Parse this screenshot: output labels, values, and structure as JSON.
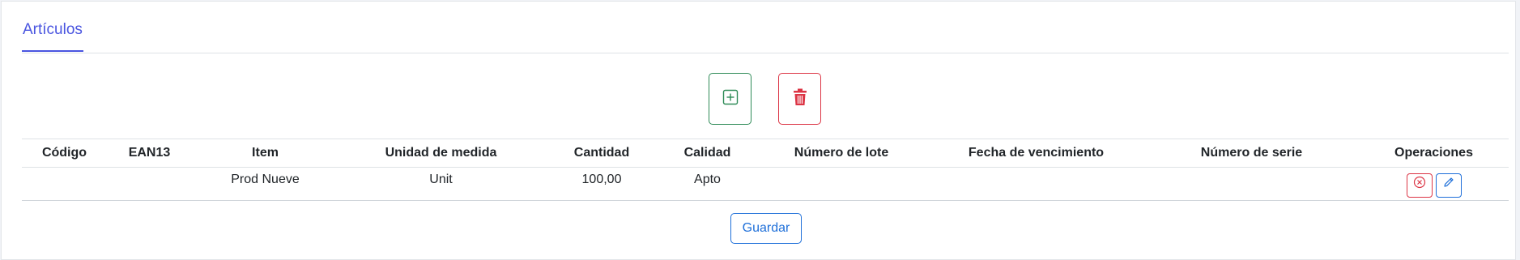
{
  "tabs": {
    "active_label": "Artículos"
  },
  "toolbar": {
    "add_icon": "plus-square-icon",
    "delete_icon": "trash-icon",
    "add_color": "#2e8b57",
    "delete_color": "#dc3545"
  },
  "table": {
    "headers": [
      "Código",
      "EAN13",
      "Item",
      "Unidad de medida",
      "Cantidad",
      "Calidad",
      "Número de lote",
      "Fecha de vencimiento",
      "Número de serie",
      "Operaciones"
    ],
    "rows": [
      {
        "codigo": "",
        "ean13": "",
        "item": "Prod Nueve",
        "unidad": "Unit",
        "cantidad": "100,00",
        "calidad": "Apto",
        "lote": "",
        "vencimiento": "",
        "serie": ""
      }
    ],
    "row_actions": [
      "cancel-circle-icon",
      "pencil-icon"
    ]
  },
  "footer": {
    "save_label": "Guardar"
  },
  "colors": {
    "accent": "#4a55e0",
    "primary": "#1e6fd9",
    "danger": "#dc3545",
    "success": "#2e8b57"
  }
}
